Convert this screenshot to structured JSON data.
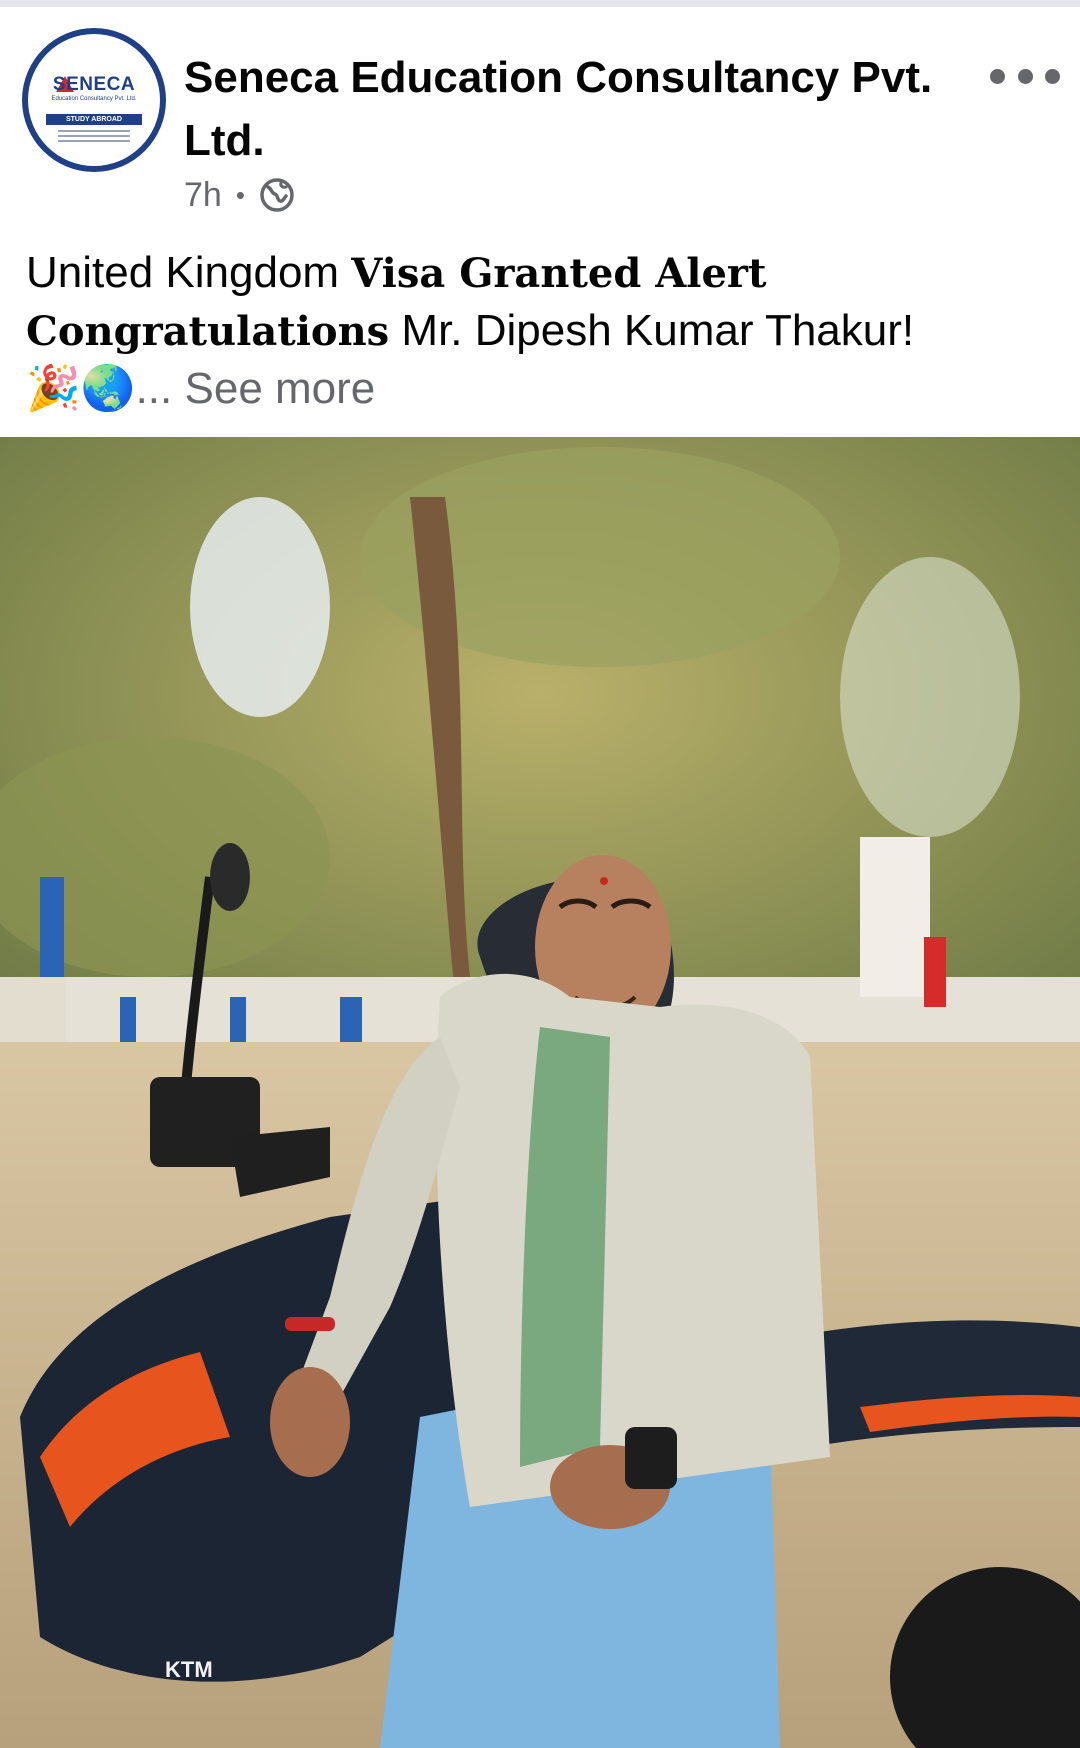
{
  "post": {
    "page_name": "Seneca Education Consultancy Pvt. Ltd.",
    "avatar_logo_text": "SENECA",
    "avatar_logo_sub": "Education Consultancy Pvt. Ltd.",
    "avatar_logo_band": "STUDY ABROAD",
    "time_ago": "7h",
    "separator": "•",
    "audience_icon": "globe-icon",
    "more_icon": "more-horizontal-icon"
  },
  "caption": {
    "line1_plain": "United Kingdom ",
    "line1_styled": "Visa Granted Alert",
    "line2_styled": "Congratulations",
    "line2_plain": " Mr. Dipesh Kumar Thakur!",
    "emojis": "🎉🌏",
    "ellipsis": "...",
    "see_more": "See more"
  },
  "photo": {
    "description_icon": "post-photo",
    "motorcycle_brand": "KTM"
  },
  "colors": {
    "text_primary": "#050505",
    "text_secondary": "#65676b",
    "brand_blue": "#1f3f86"
  }
}
